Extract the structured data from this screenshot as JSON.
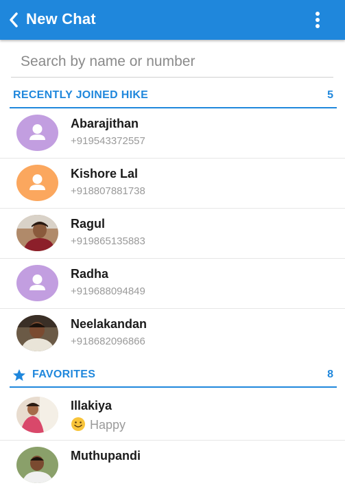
{
  "appbar": {
    "title": "New Chat",
    "back_icon": "chevron-left-icon",
    "menu_icon": "overflow-menu-icon",
    "color": "#1f87dc"
  },
  "search": {
    "placeholder": "Search by name or number",
    "value": ""
  },
  "recent": {
    "label": "RECENTLY JOINED HIKE",
    "count": "5",
    "contacts": [
      {
        "name": "Abarajithan",
        "phone": "+919543372557",
        "avatar": "default-avatar-icon",
        "avatar_color": "#c29ee0"
      },
      {
        "name": "Kishore Lal",
        "phone": "+918807881738",
        "avatar": "default-avatar-icon",
        "avatar_color": "#fba75e"
      },
      {
        "name": "Ragul",
        "phone": "+919865135883",
        "avatar": "photo"
      },
      {
        "name": "Radha",
        "phone": "+919688094849",
        "avatar": "default-avatar-icon",
        "avatar_color": "#c29ee0"
      },
      {
        "name": "Neelakandan",
        "phone": "+918682096866",
        "avatar": "photo"
      }
    ]
  },
  "favorites": {
    "label": "FAVORITES",
    "count": "8",
    "icon": "star-icon",
    "contacts": [
      {
        "name": "Illakiya",
        "status": "Happy",
        "status_icon": "smiley-emoji-icon",
        "avatar": "photo"
      },
      {
        "name": "Muthupandi",
        "avatar": "photo"
      }
    ]
  }
}
